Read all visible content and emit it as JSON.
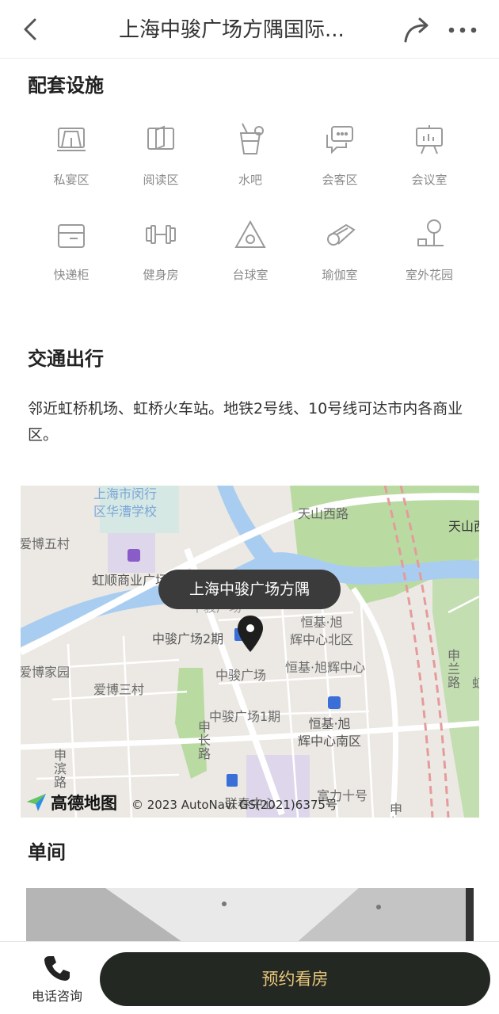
{
  "header": {
    "title": "上海中骏广场方隅国际...",
    "back_icon": "chevron-left-icon",
    "share_icon": "share-arrow-icon",
    "more_icon": "more-dots-icon"
  },
  "facilities": {
    "title": "配套设施",
    "items": [
      {
        "label": "私宴区",
        "icon": "dining-room-icon"
      },
      {
        "label": "阅读区",
        "icon": "book-icon"
      },
      {
        "label": "水吧",
        "icon": "drink-cup-icon"
      },
      {
        "label": "会客区",
        "icon": "chat-bubbles-icon"
      },
      {
        "label": "会议室",
        "icon": "presentation-board-icon"
      },
      {
        "label": "快递柜",
        "icon": "parcel-locker-icon"
      },
      {
        "label": "健身房",
        "icon": "dumbbell-icon"
      },
      {
        "label": "台球室",
        "icon": "billiards-icon"
      },
      {
        "label": "瑜伽室",
        "icon": "yoga-mat-icon"
      },
      {
        "label": "室外花园",
        "icon": "garden-tree-icon"
      }
    ]
  },
  "transport": {
    "title": "交通出行",
    "description": "邻近虹桥机场、虹桥火车站。地铁2号线、10号线可达市内各商业区。"
  },
  "map": {
    "bubble": "上海中骏广场方隅",
    "labels": {
      "school": "上海市闵行\n区华漕学校",
      "tianshan_west": "天山西路",
      "tianshan": "天山西",
      "aibo5": "爱博五村",
      "hongshun": "虹顺商业广场",
      "zhongjun_building": "中骏广场",
      "zhongjun2": "中骏广场2期",
      "henji_north": "恒基·旭\n辉中心北区",
      "aibo_home": "爱博家园",
      "hengji_center": "恒基·旭辉中心",
      "zhongjun_plaza": "中骏广场",
      "aibo3": "爱博三村",
      "zhonglan": "申兰路",
      "zhongjun1": "中骏广场1期",
      "hengji_south": "恒基·旭\n辉中心南区",
      "shenchang": "申长路",
      "shenbin": "申滨路",
      "lianchun": "联春中心",
      "fuli": "富力十号",
      "shenhong": "申虹路",
      "hong": "虹"
    },
    "logo_text": "高德地图",
    "copyright": "© 2023 AutoNavi  GS(2021)6375号",
    "colors": {
      "water": "#a9cdf0",
      "green": "#b9dba2",
      "land": "#ece9e4",
      "road": "#ffffff"
    }
  },
  "rooms": {
    "title": "单间"
  },
  "bottom": {
    "call_label": "电话咨询",
    "book_label": "预约看房",
    "accent": "#e8c77c",
    "button_bg": "#242823"
  }
}
